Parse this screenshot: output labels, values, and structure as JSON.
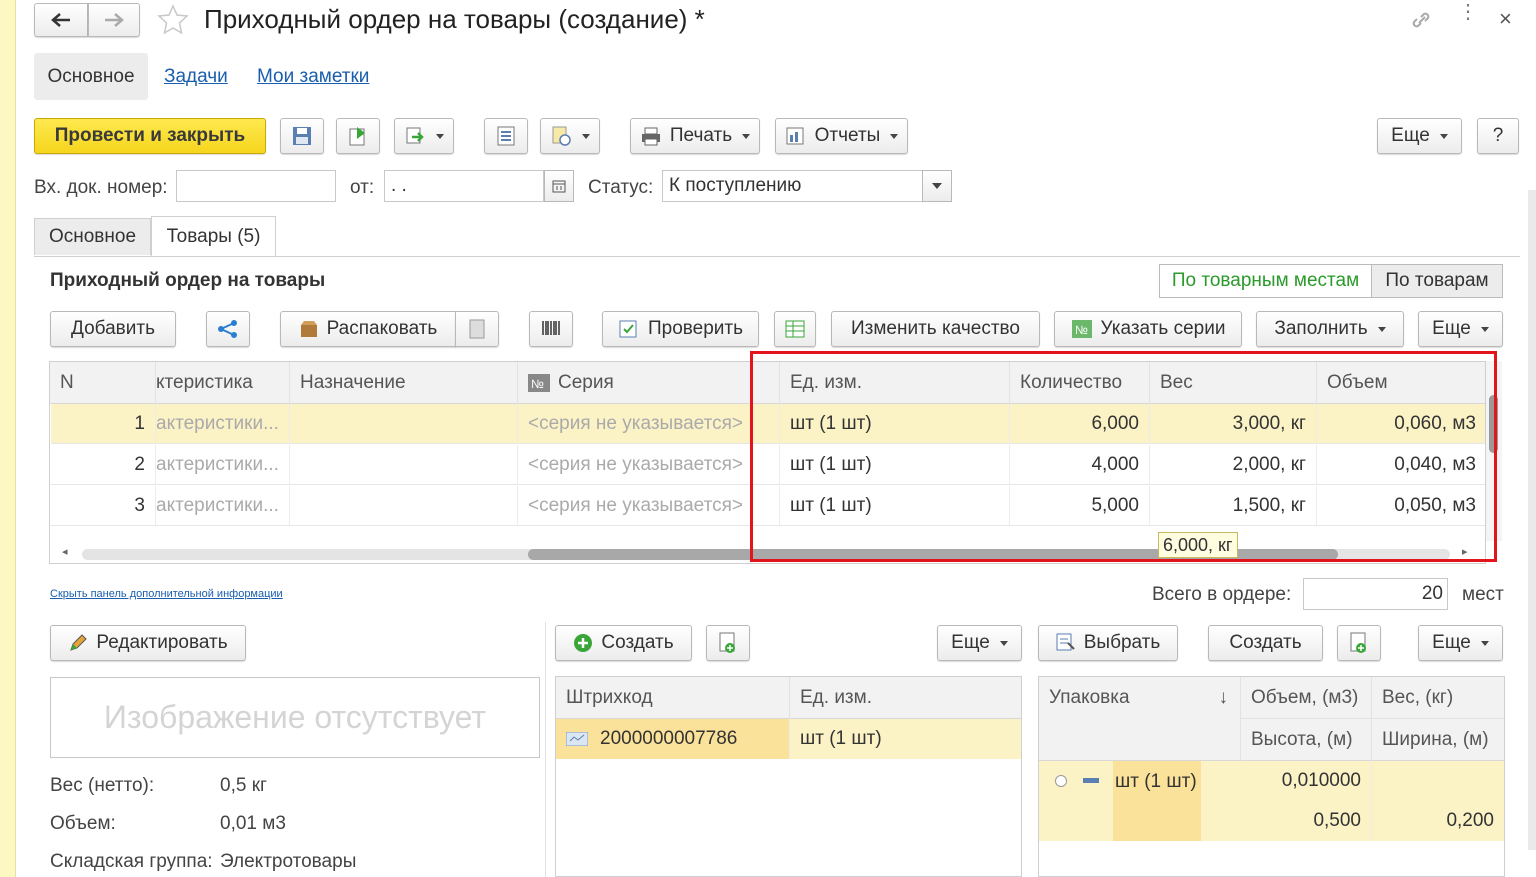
{
  "window": {
    "title": "Приходный ордер на товары (создание) *"
  },
  "nav_tabs": [
    "Основное",
    "Задачи",
    "Мои заметки"
  ],
  "toolbar": {
    "post_close": "Провести и закрыть",
    "print": "Печать",
    "reports": "Отчеты",
    "more": "Еще",
    "help": "?"
  },
  "header_form": {
    "inc_label": "Вх. док. номер:",
    "inc_value": "",
    "from_label": "от:",
    "from_value": " .  .",
    "status_label": "Статус:",
    "status_value": "К поступлению"
  },
  "tabs": [
    "Основное",
    "Товары (5)"
  ],
  "section": {
    "title": "Приходный ордер на товары",
    "toggle_left": "По товарным местам",
    "toggle_right": "По товарам"
  },
  "goods_toolbar": {
    "add": "Добавить",
    "unpack": "Распаковать",
    "check": "Проверить",
    "change_quality": "Изменить качество",
    "set_series": "Указать серии",
    "fill": "Заполнить",
    "more": "Еще"
  },
  "table": {
    "columns": [
      "N",
      "ктеристика",
      "Назначение",
      "Серия",
      "Ед. изм.",
      "Количество",
      "Вес",
      "Объем"
    ],
    "rows": [
      {
        "n": "1",
        "char": "актеристики...",
        "purpose": "",
        "series": "<серия не указывается>",
        "unit": "шт (1 шт)",
        "qty": "6,000",
        "weight": "3,000, кг",
        "volume": "0,060, м3"
      },
      {
        "n": "2",
        "char": "актеристики...",
        "purpose": "",
        "series": "<серия не указывается>",
        "unit": "шт (1 шт)",
        "qty": "4,000",
        "weight": "2,000, кг",
        "volume": "0,040, м3"
      },
      {
        "n": "3",
        "char": "актеристики...",
        "purpose": "",
        "series": "<серия не указывается>",
        "unit": "шт (1 шт)",
        "qty": "5,000",
        "weight": "1,500, кг",
        "volume": "0,050, м3"
      }
    ],
    "tooltip": "6,000, кг"
  },
  "hide_panel_link": "Скрыть панель дополнительной информации",
  "total": {
    "label": "Всего в ордере:",
    "value": "20",
    "unit": "мест"
  },
  "left_panel": {
    "edit": "Редактировать",
    "no_image": "Изображение отсутствует",
    "weight_label": "Вес (нетто):",
    "weight_value": "0,5 кг",
    "volume_label": "Объем:",
    "volume_value": "0,01 м3",
    "group_label": "Складская группа:",
    "group_value": "Электротовары"
  },
  "barcode_panel": {
    "create": "Создать",
    "more": "Еще",
    "col_barcode": "Штрихкод",
    "col_unit": "Ед. изм.",
    "barcode": "2000000007786",
    "unit": "шт (1 шт)"
  },
  "pack_panel": {
    "select": "Выбрать",
    "create": "Создать",
    "more": "Еще",
    "col_pack": "Упаковка",
    "sort_arrow": "↓",
    "col_volume": "Объем, (м3)",
    "col_weight": "Вес, (кг)",
    "col_height": "Высота, (м)",
    "col_width": "Ширина, (м)",
    "pack": "шт (1 шт)",
    "volume": "0,010000",
    "height": "0,500",
    "width": "0,200"
  },
  "colors": {
    "accent_yellow": "#fde13c",
    "highlight": "#fbf2c6",
    "red_frame": "#e3141c",
    "link": "#1a5eae"
  }
}
